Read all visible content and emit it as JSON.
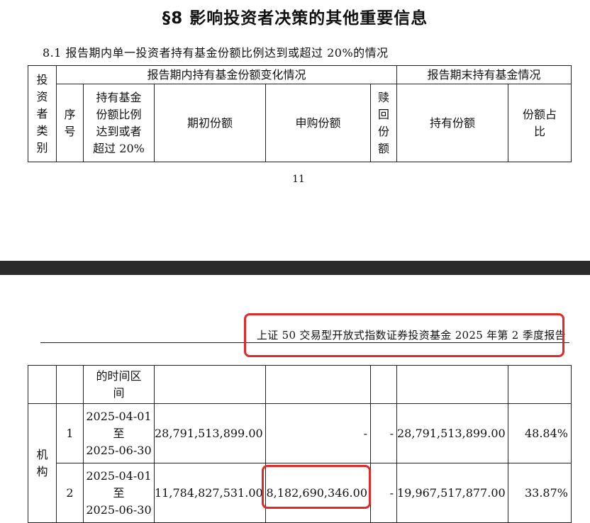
{
  "section": {
    "title": "§8 影响投资者决策的其他重要信息"
  },
  "subsection": {
    "title": "8.1 报告期内单一投资者持有基金份额比例达到或超过 20%的情况"
  },
  "table_header": {
    "investor_type": [
      "投",
      "资",
      "者",
      "类",
      "别"
    ],
    "period_change_group": "报告期内持有基金份额变化情况",
    "period_end_group": "报告期末持有基金情况",
    "seq": [
      "序",
      "号"
    ],
    "ratio_period": [
      "持有基金",
      "份额比例",
      "达到或者",
      "超过 20%"
    ],
    "initial_shares": "期初份额",
    "subscription_shares": "申购份额",
    "redemption_shares": [
      "赎",
      "回",
      "份",
      "额"
    ],
    "held_shares": "持有份额",
    "share_ratio": [
      "份额占",
      "比"
    ]
  },
  "page": {
    "number": "11"
  },
  "running_header": "上证 50 交易型开放式指数证券投资基金 2025 年第 2 季度报告",
  "table_continued": {
    "ratio_period_tail": [
      "的时间区",
      "间"
    ],
    "investor_type": [
      "机",
      "构"
    ],
    "rows": [
      {
        "seq": "1",
        "period": [
          "2025-04-01",
          "至",
          "2025-06-30"
        ],
        "initial": "28,791,513,899.00",
        "subscription": "-",
        "redemption": "-",
        "held": "28,791,513,899.00",
        "ratio": "48.84%"
      },
      {
        "seq": "2",
        "period": [
          "2025-04-01",
          "至",
          "2025-06-30"
        ],
        "initial": "11,784,827,531.00",
        "subscription": "8,182,690,346.00",
        "redemption": "-",
        "held": "19,967,517,877.00",
        "ratio": "33.87%"
      }
    ]
  }
}
